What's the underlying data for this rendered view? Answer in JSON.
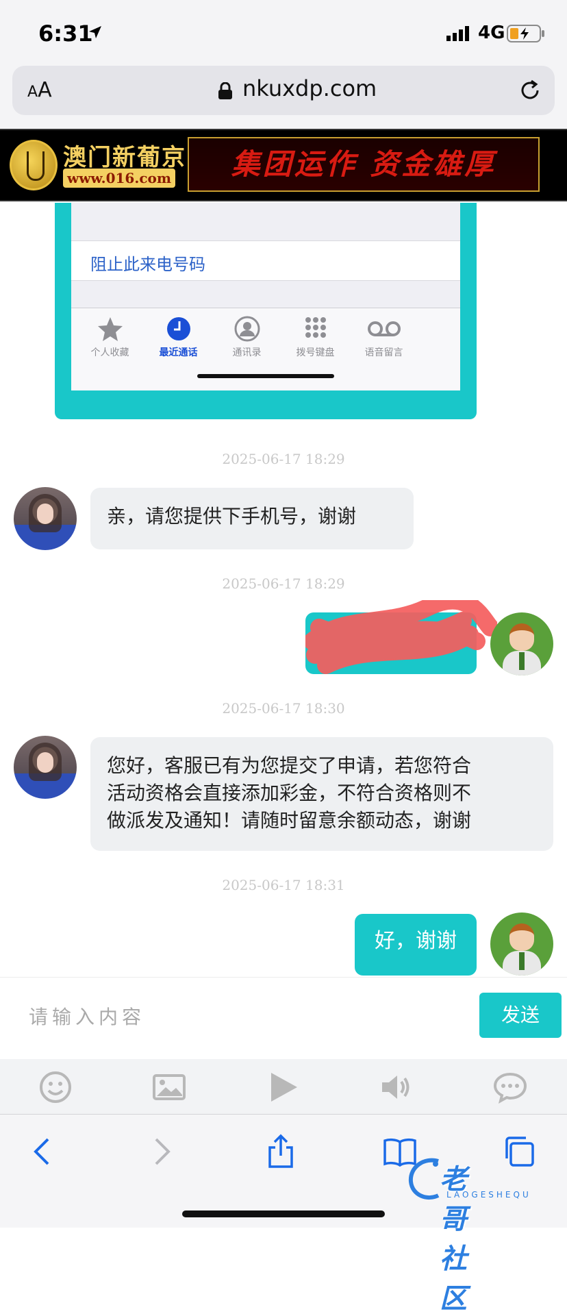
{
  "status_bar": {
    "time": "6:31",
    "network": "4G"
  },
  "browser": {
    "text_size_label": "AA",
    "url": "nkuxdp.com"
  },
  "banner": {
    "brand": "澳门新葡京",
    "website": "www.016.com",
    "slogan": "集团运作  资金雄厚"
  },
  "screenshot": {
    "block_label": "阻止此来电号码",
    "tabs": [
      {
        "label": "个人收藏",
        "icon": "star-icon"
      },
      {
        "label": "最近通话",
        "icon": "clock-icon",
        "active": true
      },
      {
        "label": "通讯录",
        "icon": "contacts-icon"
      },
      {
        "label": "拨号键盘",
        "icon": "keypad-icon"
      },
      {
        "label": "语音留言",
        "icon": "voicemail-icon"
      }
    ]
  },
  "messages": [
    {
      "timestamp": "2025-06-17 18:29",
      "side": "left",
      "text": "亲，请您提供下手机号，谢谢"
    },
    {
      "timestamp": "2025-06-17 18:29",
      "side": "right",
      "text": "",
      "redacted": true
    },
    {
      "timestamp": "2025-06-17 18:30",
      "side": "left",
      "lines": [
        "您好，客服已有为您提交了申请，若您符合",
        "活动资格会直接添加彩金，不符合资格则不",
        "做派发及通知！请随时留意余额动态，谢谢"
      ]
    },
    {
      "timestamp": "2025-06-17 18:31",
      "side": "right",
      "text": "好，谢谢"
    }
  ],
  "input": {
    "placeholder": "请输入内容",
    "send_label": "发送"
  },
  "chat_tools": [
    "emoji-icon",
    "image-icon",
    "play-icon",
    "speaker-icon",
    "chat-icon"
  ],
  "safari_bar": [
    "back-icon",
    "forward-icon",
    "share-icon",
    "bookmarks-icon",
    "tabs-icon"
  ],
  "watermark": {
    "text": "老哥社区",
    "sub": "LAOGESHEQU"
  },
  "colors": {
    "accent": "#19c7c9",
    "bubble_left": "#eef0f2",
    "link_blue": "#2c62c8",
    "banner_red": "#d81b12",
    "banner_gold": "#f4d062"
  }
}
